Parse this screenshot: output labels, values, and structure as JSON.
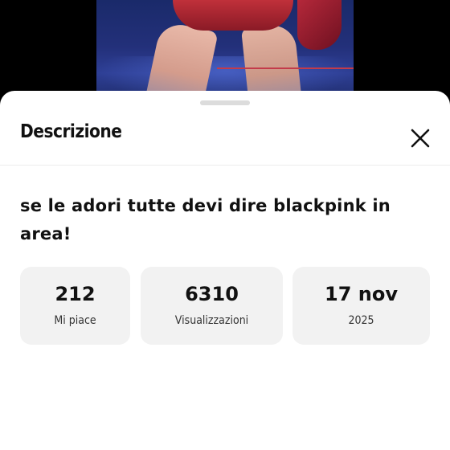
{
  "video": {
    "accent_color": "#c0303a"
  },
  "sheet": {
    "title": "Descrizione",
    "close_icon": "close-icon",
    "description": "se le adori tutte devi dire blackpink in area!"
  },
  "stats": [
    {
      "value": "212",
      "label": "Mi piace"
    },
    {
      "value": "6310",
      "label": "Visualizzazioni"
    },
    {
      "value": "17 nov",
      "label": "2025"
    }
  ]
}
